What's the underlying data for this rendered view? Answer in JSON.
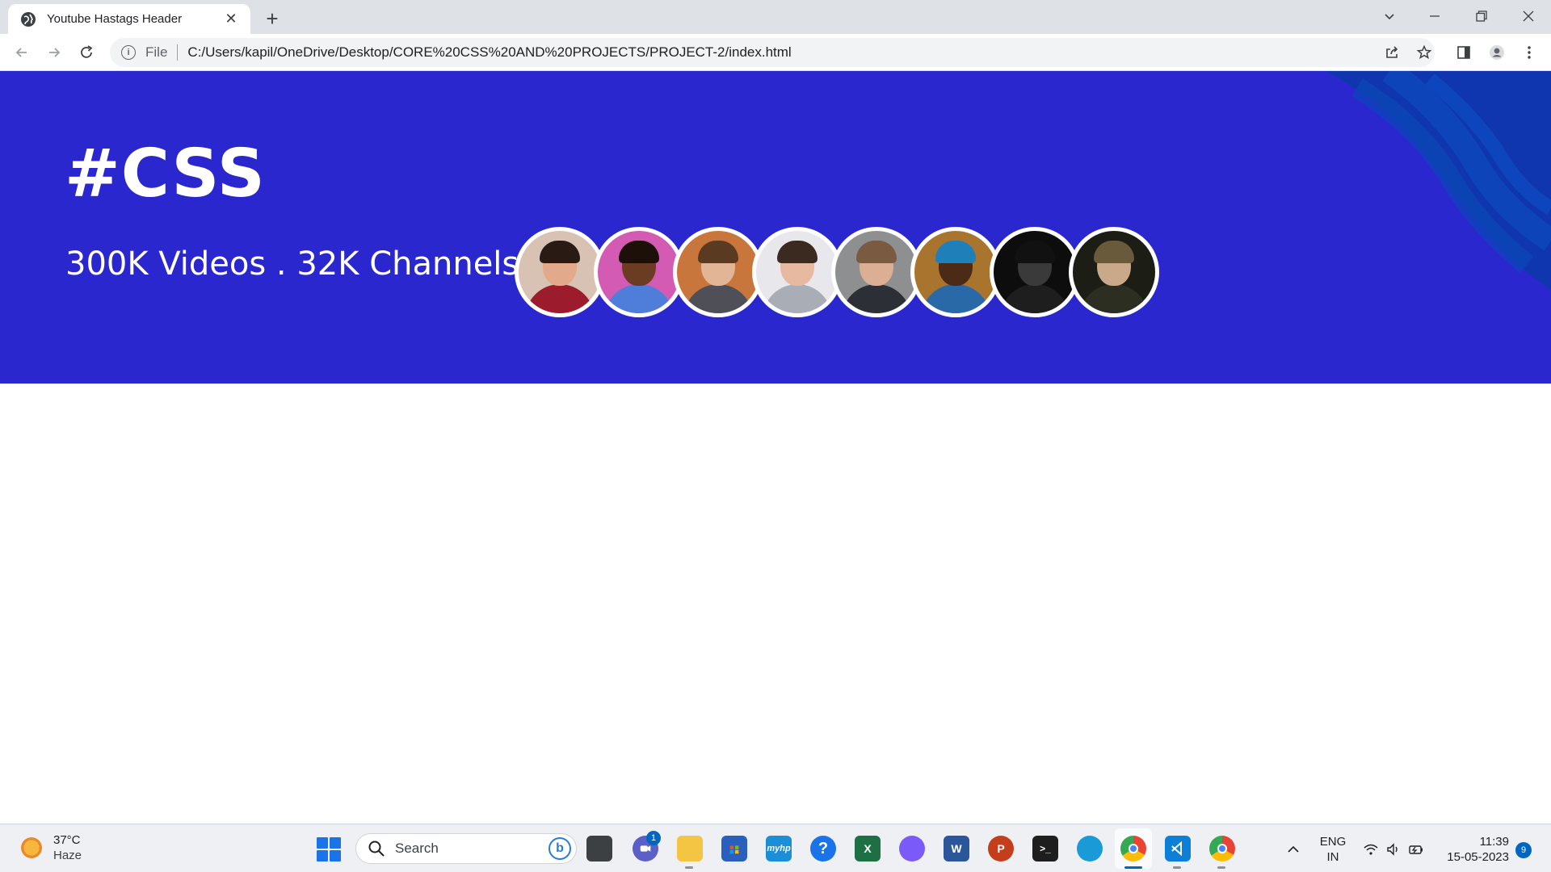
{
  "browser": {
    "tab_title": "Youtube Hastags Header",
    "address_scheme": "File",
    "address_url": "C:/Users/kapil/OneDrive/Desktop/CORE%20CSS%20AND%20PROJECTS/PROJECT-2/index.html"
  },
  "page": {
    "hashtag": "#CSS",
    "stats": "300K Videos . 32K Channels",
    "colors": {
      "header_bg": "#2a27cf",
      "text": "#ffffff"
    },
    "avatars": [
      {
        "name": "avatar-1",
        "bg": "#d7c2b4",
        "skin": "#e2a98a",
        "hair": "#2a1a14",
        "shirt": "#9c1b2c"
      },
      {
        "name": "avatar-2",
        "bg": "#d45bb3",
        "skin": "#6b3b22",
        "hair": "#1c1008",
        "shirt": "#4e7ed9"
      },
      {
        "name": "avatar-3",
        "bg": "#c9763c",
        "skin": "#e3b597",
        "hair": "#5b3a22",
        "shirt": "#4e4f57"
      },
      {
        "name": "avatar-4",
        "bg": "#e8e8ec",
        "skin": "#e7b9a0",
        "hair": "#3b2a20",
        "shirt": "#a9adb5"
      },
      {
        "name": "avatar-5",
        "bg": "#8e8f91",
        "skin": "#dcae94",
        "hair": "#7a5a40",
        "shirt": "#2c3036"
      },
      {
        "name": "avatar-6",
        "bg": "#a8742e",
        "skin": "#4b2a16",
        "hair": "#1f7fb8",
        "shirt": "#2a69a8"
      },
      {
        "name": "avatar-7",
        "bg": "#0d0d0d",
        "skin": "#3a3a3a",
        "hair": "#111111",
        "shirt": "#1e1e1e"
      },
      {
        "name": "avatar-8",
        "bg": "#1c1e16",
        "skin": "#c9a989",
        "hair": "#6a5a3c",
        "shirt": "#2c2e22"
      }
    ]
  },
  "taskbar": {
    "weather_temp": "37°C",
    "weather_cond": "Haze",
    "search_placeholder": "Search",
    "teams_badge": "1",
    "lang_top": "ENG",
    "lang_bottom": "IN",
    "time": "11:39",
    "date": "15-05-2023",
    "notif_count": "9"
  }
}
